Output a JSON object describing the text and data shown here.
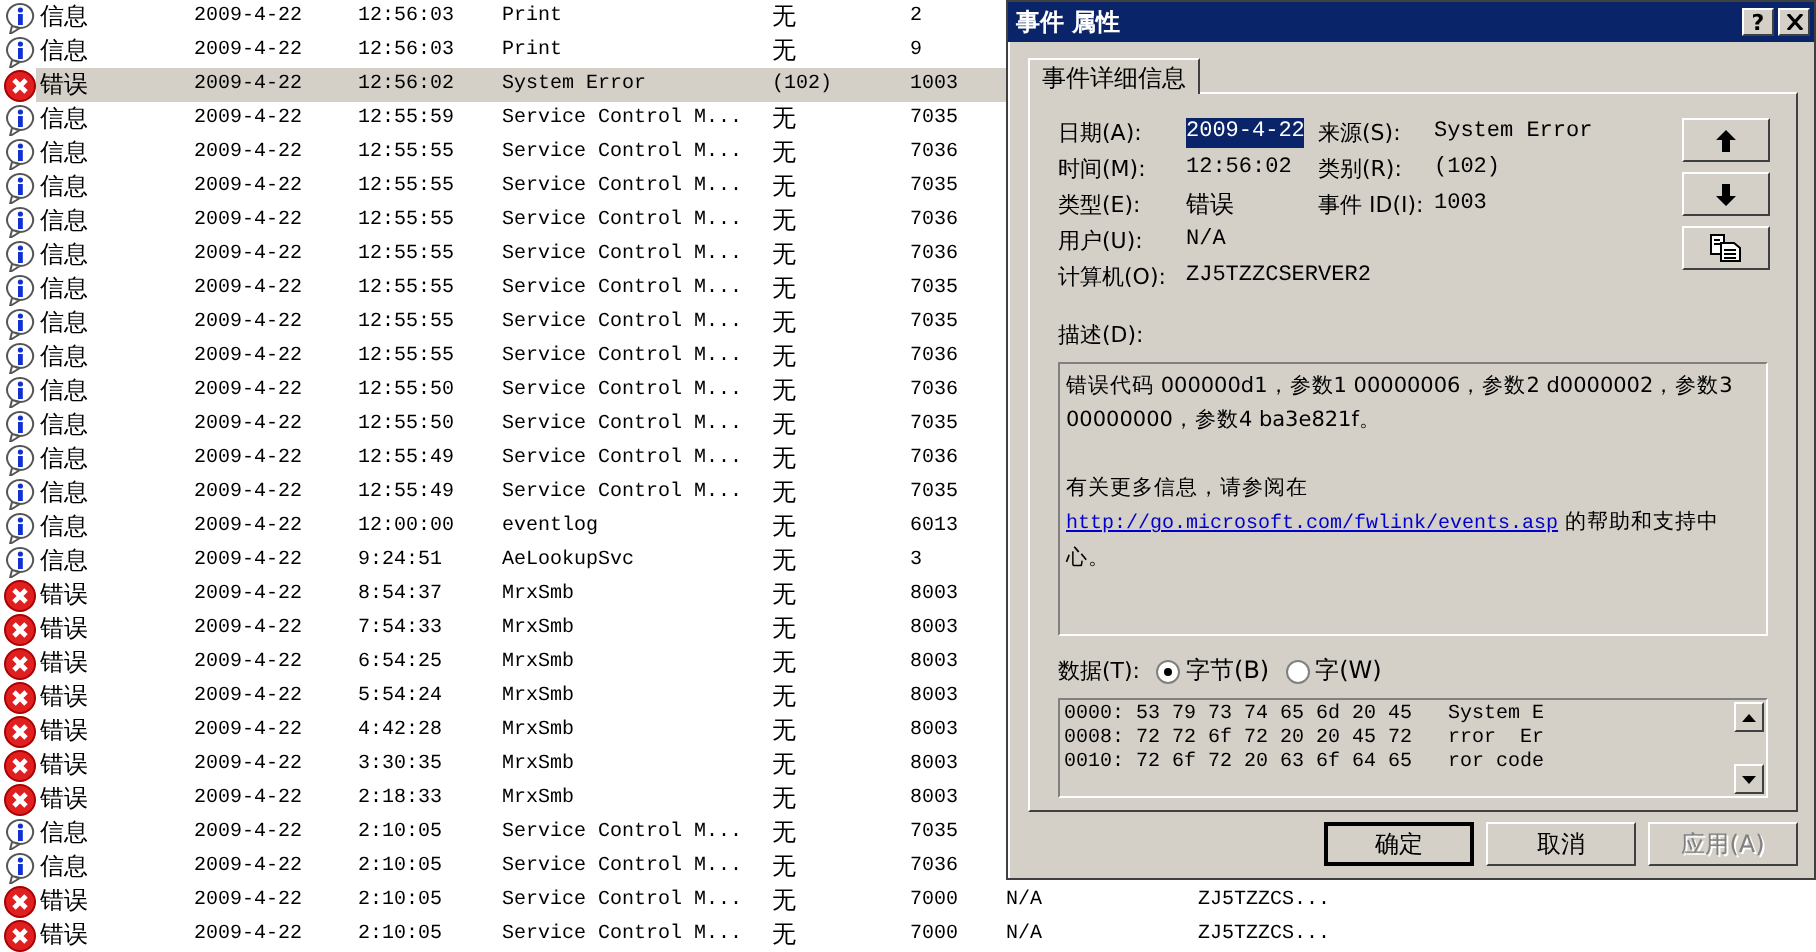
{
  "log": {
    "rows": [
      {
        "kind": "info",
        "type": "信息",
        "date": "2009-4-22",
        "time": "12:56:03",
        "source": "Print",
        "category": "无",
        "event": "2",
        "selected": false
      },
      {
        "kind": "info",
        "type": "信息",
        "date": "2009-4-22",
        "time": "12:56:03",
        "source": "Print",
        "category": "无",
        "event": "9",
        "selected": false
      },
      {
        "kind": "error",
        "type": "错误",
        "date": "2009-4-22",
        "time": "12:56:02",
        "source": "System Error",
        "category": "(102)",
        "event": "1003",
        "selected": true
      },
      {
        "kind": "info",
        "type": "信息",
        "date": "2009-4-22",
        "time": "12:55:59",
        "source": "Service Control M...",
        "category": "无",
        "event": "7035",
        "selected": false
      },
      {
        "kind": "info",
        "type": "信息",
        "date": "2009-4-22",
        "time": "12:55:55",
        "source": "Service Control M...",
        "category": "无",
        "event": "7036",
        "selected": false
      },
      {
        "kind": "info",
        "type": "信息",
        "date": "2009-4-22",
        "time": "12:55:55",
        "source": "Service Control M...",
        "category": "无",
        "event": "7035",
        "selected": false
      },
      {
        "kind": "info",
        "type": "信息",
        "date": "2009-4-22",
        "time": "12:55:55",
        "source": "Service Control M...",
        "category": "无",
        "event": "7036",
        "selected": false
      },
      {
        "kind": "info",
        "type": "信息",
        "date": "2009-4-22",
        "time": "12:55:55",
        "source": "Service Control M...",
        "category": "无",
        "event": "7036",
        "selected": false
      },
      {
        "kind": "info",
        "type": "信息",
        "date": "2009-4-22",
        "time": "12:55:55",
        "source": "Service Control M...",
        "category": "无",
        "event": "7035",
        "selected": false
      },
      {
        "kind": "info",
        "type": "信息",
        "date": "2009-4-22",
        "time": "12:55:55",
        "source": "Service Control M...",
        "category": "无",
        "event": "7035",
        "selected": false
      },
      {
        "kind": "info",
        "type": "信息",
        "date": "2009-4-22",
        "time": "12:55:55",
        "source": "Service Control M...",
        "category": "无",
        "event": "7036",
        "selected": false
      },
      {
        "kind": "info",
        "type": "信息",
        "date": "2009-4-22",
        "time": "12:55:50",
        "source": "Service Control M...",
        "category": "无",
        "event": "7036",
        "selected": false
      },
      {
        "kind": "info",
        "type": "信息",
        "date": "2009-4-22",
        "time": "12:55:50",
        "source": "Service Control M...",
        "category": "无",
        "event": "7035",
        "selected": false
      },
      {
        "kind": "info",
        "type": "信息",
        "date": "2009-4-22",
        "time": "12:55:49",
        "source": "Service Control M...",
        "category": "无",
        "event": "7036",
        "selected": false
      },
      {
        "kind": "info",
        "type": "信息",
        "date": "2009-4-22",
        "time": "12:55:49",
        "source": "Service Control M...",
        "category": "无",
        "event": "7035",
        "selected": false
      },
      {
        "kind": "info",
        "type": "信息",
        "date": "2009-4-22",
        "time": "12:00:00",
        "source": "eventlog",
        "category": "无",
        "event": "6013",
        "selected": false
      },
      {
        "kind": "info",
        "type": "信息",
        "date": "2009-4-22",
        "time": "9:24:51",
        "source": "AeLookupSvc",
        "category": "无",
        "event": "3",
        "selected": false
      },
      {
        "kind": "error",
        "type": "错误",
        "date": "2009-4-22",
        "time": "8:54:37",
        "source": "MrxSmb",
        "category": "无",
        "event": "8003",
        "selected": false
      },
      {
        "kind": "error",
        "type": "错误",
        "date": "2009-4-22",
        "time": "7:54:33",
        "source": "MrxSmb",
        "category": "无",
        "event": "8003",
        "selected": false
      },
      {
        "kind": "error",
        "type": "错误",
        "date": "2009-4-22",
        "time": "6:54:25",
        "source": "MrxSmb",
        "category": "无",
        "event": "8003",
        "selected": false
      },
      {
        "kind": "error",
        "type": "错误",
        "date": "2009-4-22",
        "time": "5:54:24",
        "source": "MrxSmb",
        "category": "无",
        "event": "8003",
        "selected": false
      },
      {
        "kind": "error",
        "type": "错误",
        "date": "2009-4-22",
        "time": "4:42:28",
        "source": "MrxSmb",
        "category": "无",
        "event": "8003",
        "selected": false
      },
      {
        "kind": "error",
        "type": "错误",
        "date": "2009-4-22",
        "time": "3:30:35",
        "source": "MrxSmb",
        "category": "无",
        "event": "8003",
        "selected": false
      },
      {
        "kind": "error",
        "type": "错误",
        "date": "2009-4-22",
        "time": "2:18:33",
        "source": "MrxSmb",
        "category": "无",
        "event": "8003",
        "selected": false
      },
      {
        "kind": "info",
        "type": "信息",
        "date": "2009-4-22",
        "time": "2:10:05",
        "source": "Service Control M...",
        "category": "无",
        "event": "7035",
        "selected": false
      },
      {
        "kind": "info",
        "type": "信息",
        "date": "2009-4-22",
        "time": "2:10:05",
        "source": "Service Control M...",
        "category": "无",
        "event": "7036",
        "selected": false
      },
      {
        "kind": "error",
        "type": "错误",
        "date": "2009-4-22",
        "time": "2:10:05",
        "source": "Service Control M...",
        "category": "无",
        "event": "7000",
        "user": "N/A",
        "computer": "ZJ5TZZCS...",
        "selected": false
      },
      {
        "kind": "error",
        "type": "错误",
        "date": "2009-4-22",
        "time": "2:10:05",
        "source": "Service Control M...",
        "category": "无",
        "event": "7000",
        "user": "N/A",
        "computer": "ZJ5TZZCS...",
        "selected": false
      }
    ]
  },
  "dialog": {
    "title": "事件 属性",
    "help": "?",
    "tabs": [
      {
        "label": "事件详细信息",
        "selected": true
      }
    ],
    "fields_left": [
      {
        "label": "日期(A):",
        "value": "2009-4-22",
        "selected": true
      },
      {
        "label": "时间(M):",
        "value": "12:56:02",
        "selected": false
      },
      {
        "label": "类型(E):",
        "value": "错误",
        "selected": false
      },
      {
        "label": "用户(U):",
        "value": "N/A",
        "selected": false
      },
      {
        "label": "计算机(O):",
        "value": "ZJ5TZZCSERVER2",
        "selected": false
      }
    ],
    "fields_right": [
      {
        "label": "来源(S):",
        "value": "System Error"
      },
      {
        "label": "类别(R):",
        "value": "(102)"
      },
      {
        "label": "事件 ID(I):",
        "value": "1003"
      }
    ],
    "description_label": "描述(D):",
    "description": {
      "text": "错误代码 000000d1，参数1 00000006，参数2 d0000002，参数3 00000000，参数4 ba3e821f。",
      "more_before": "有关更多信息，请参阅在",
      "link": "http://go.microsoft.com/fwlink/events.asp",
      "more_after": "的帮助和支持中心。"
    },
    "data_label": "数据(T):",
    "data_format": [
      {
        "label": "字节(B)",
        "selected": true
      },
      {
        "label": "字(W)",
        "selected": false
      }
    ],
    "data_lines": [
      "0000: 53 79 73 74 65 6d 20 45   System E",
      "0008: 72 72 6f 72 20 20 45 72   rror  Er",
      "0010: 72 6f 72 20 63 6f 64 65   ror code"
    ],
    "buttons": [
      {
        "label": "确定",
        "default": true,
        "disabled": false
      },
      {
        "label": "取消",
        "default": false,
        "disabled": false
      },
      {
        "label": "应用(A)",
        "default": false,
        "disabled": true
      }
    ]
  }
}
